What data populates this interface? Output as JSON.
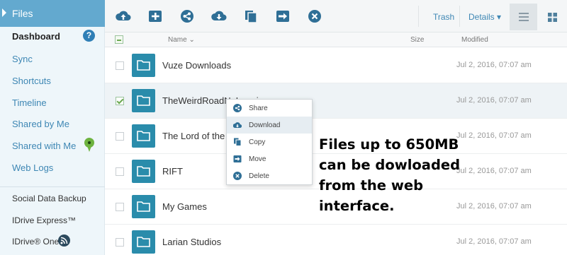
{
  "sidebar": {
    "active_label": "Files",
    "items": [
      "Dashboard",
      "Sync",
      "Shortcuts",
      "Timeline",
      "Shared by Me",
      "Shared with Me",
      "Web Logs"
    ],
    "bottom_items": [
      "Social Data Backup",
      "IDrive Express™",
      "IDrive® One"
    ],
    "help_badge": "?"
  },
  "toolbar": {
    "buttons": [
      "upload-icon",
      "new-folder-icon",
      "share-icon",
      "download-icon",
      "copy-icon",
      "move-icon",
      "delete-icon"
    ],
    "trash_label": "Trash",
    "details_label": "Details ▾"
  },
  "columns": {
    "name": "Name ⌄",
    "size": "Size",
    "modified": "Modified"
  },
  "files": [
    {
      "name": "Vuze Downloads",
      "modified": "Jul 2, 2016, 07:07 am",
      "checked": false
    },
    {
      "name": "TheWeirdRoadNoLoopir",
      "modified": "Jul 2, 2016, 07:07 am",
      "checked": true
    },
    {
      "name": "The Lord of the",
      "modified": "Jul 2, 2016, 07:07 am",
      "checked": false
    },
    {
      "name": "RIFT",
      "modified": "Jul 2, 2016, 07:07 am",
      "checked": false
    },
    {
      "name": "My Games",
      "modified": "Jul 2, 2016, 07:07 am",
      "checked": false
    },
    {
      "name": "Larian Studios",
      "modified": "Jul 2, 2016, 07:07 am",
      "checked": false
    }
  ],
  "context_menu": {
    "items": [
      {
        "label": "Share",
        "icon": "share-icon"
      },
      {
        "label": "Download",
        "icon": "download-icon",
        "highlighted": true
      },
      {
        "label": "Copy",
        "icon": "copy-icon"
      },
      {
        "label": "Move",
        "icon": "move-icon"
      },
      {
        "label": "Delete",
        "icon": "delete-icon"
      }
    ]
  },
  "annotation": {
    "lines": [
      "Files up to 650MB",
      "can be dowloaded",
      "from the web",
      "interface."
    ]
  },
  "colors": {
    "accent": "#63a9cf",
    "folder": "#2a8cab",
    "link": "#3e87b4",
    "toolbar_icon": "#2f6f96"
  }
}
